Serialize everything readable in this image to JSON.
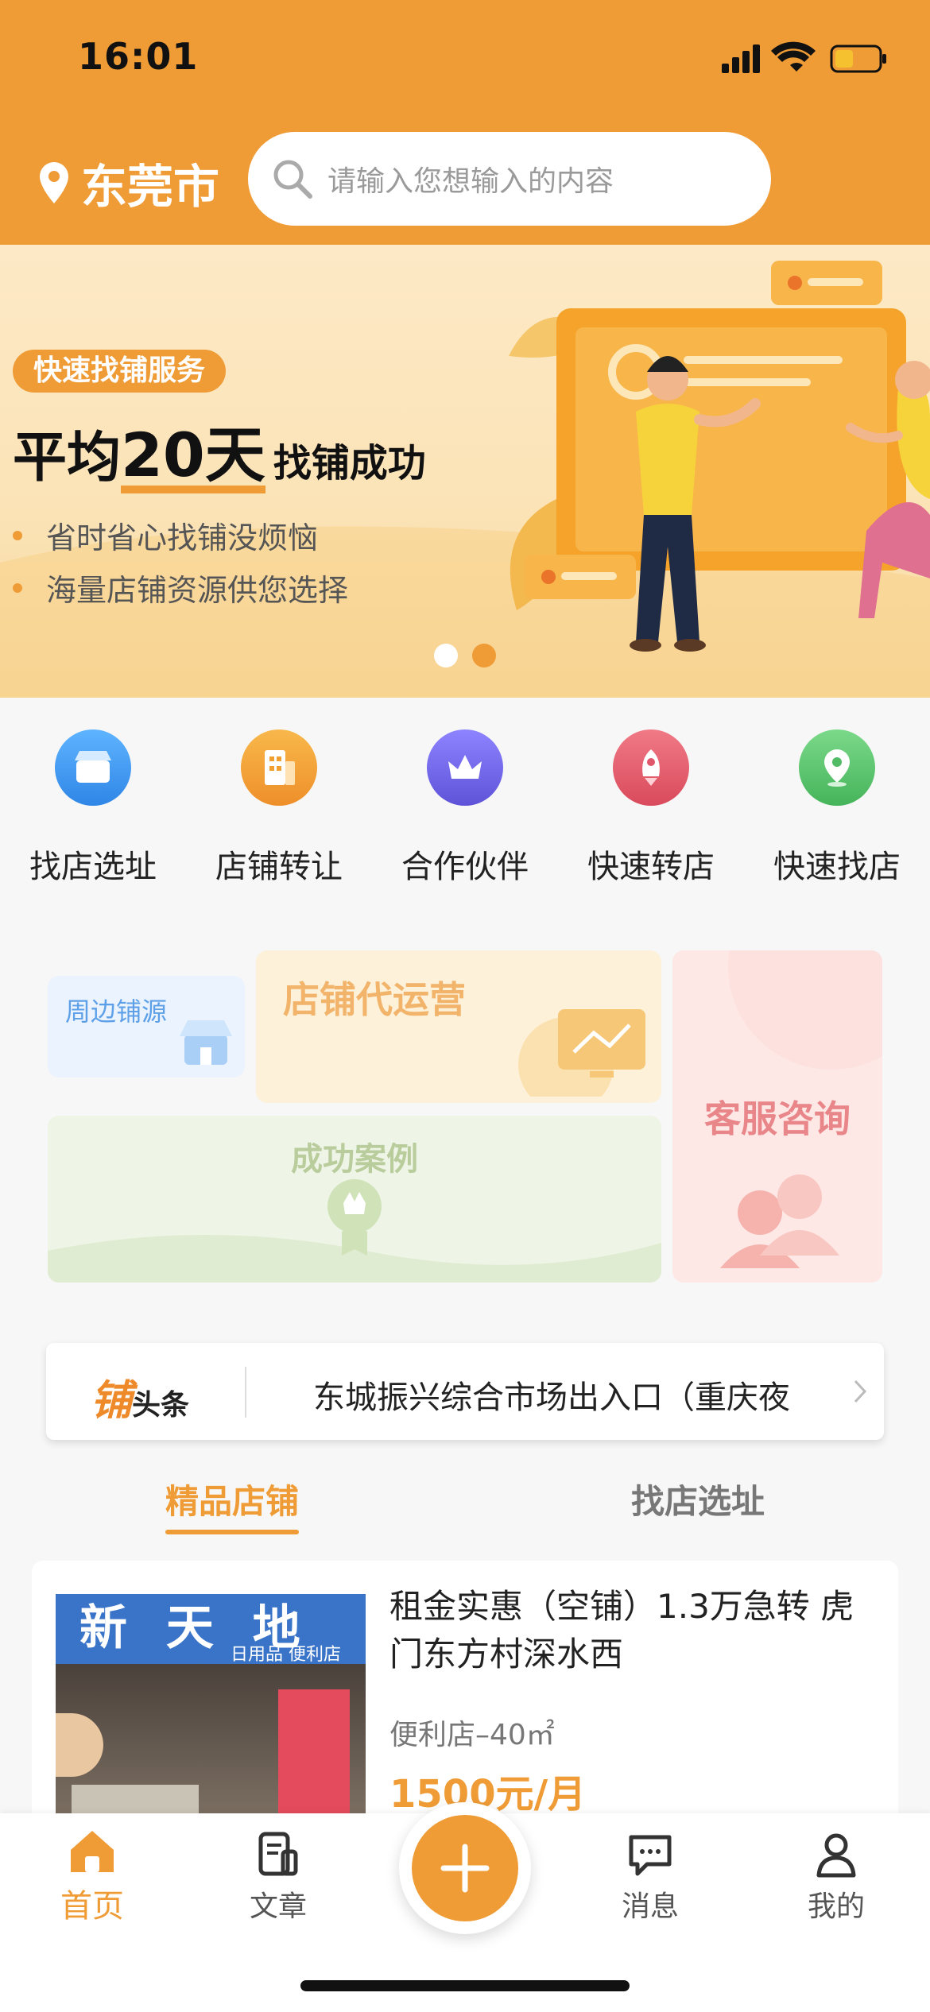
{
  "status_bar": {
    "time": "16:01"
  },
  "header": {
    "city": "东莞市",
    "search_placeholder": "请输入您想输入的内容"
  },
  "banner": {
    "badge": "快速找铺服务",
    "headline_prefix": "平均",
    "headline_number": "20天",
    "headline_suffix": "找铺成功",
    "bullets": [
      "省时省心找铺没烦恼",
      "海量店铺资源供您选择"
    ],
    "active_dot": 1
  },
  "menu": [
    {
      "label": "找店选址",
      "icon": "store-icon",
      "color": "#3f99ee"
    },
    {
      "label": "店铺转让",
      "icon": "building-icon",
      "color": "#f0a030"
    },
    {
      "label": "合作伙伴",
      "icon": "crown-icon",
      "color": "#7a6ce6"
    },
    {
      "label": "快速转店",
      "icon": "rocket-icon",
      "color": "#e65a6a"
    },
    {
      "label": "快速找店",
      "icon": "location-pin-icon",
      "color": "#5cc66d"
    }
  ],
  "features": {
    "nearby": "周边铺源",
    "operation": "店铺代运营",
    "cases": "成功案例",
    "service": "客服咨询"
  },
  "ticker": {
    "logo_main": "铺",
    "logo_sub": "头条",
    "text": "东城振兴综合市场出入口（重庆夜"
  },
  "tabs": [
    {
      "label": "精品店铺",
      "active": true
    },
    {
      "label": "找店选址",
      "active": false
    }
  ],
  "listing": {
    "title": "租金实惠（空铺）1.3万急转 虎门东方村深水西",
    "meta": "便利店–40㎡",
    "price": "1500元/月",
    "image_sign": "新 天 地",
    "image_subsign": "日用品 便利店"
  },
  "bottom_nav": [
    {
      "label": "首页",
      "icon": "home-icon",
      "active": true
    },
    {
      "label": "文章",
      "icon": "article-icon",
      "active": false
    },
    {
      "label": "消息",
      "icon": "message-icon",
      "active": false
    },
    {
      "label": "我的",
      "icon": "user-icon",
      "active": false
    }
  ],
  "colors": {
    "brand": "#f09c36",
    "text": "#333333",
    "muted": "#9a9a9a"
  }
}
